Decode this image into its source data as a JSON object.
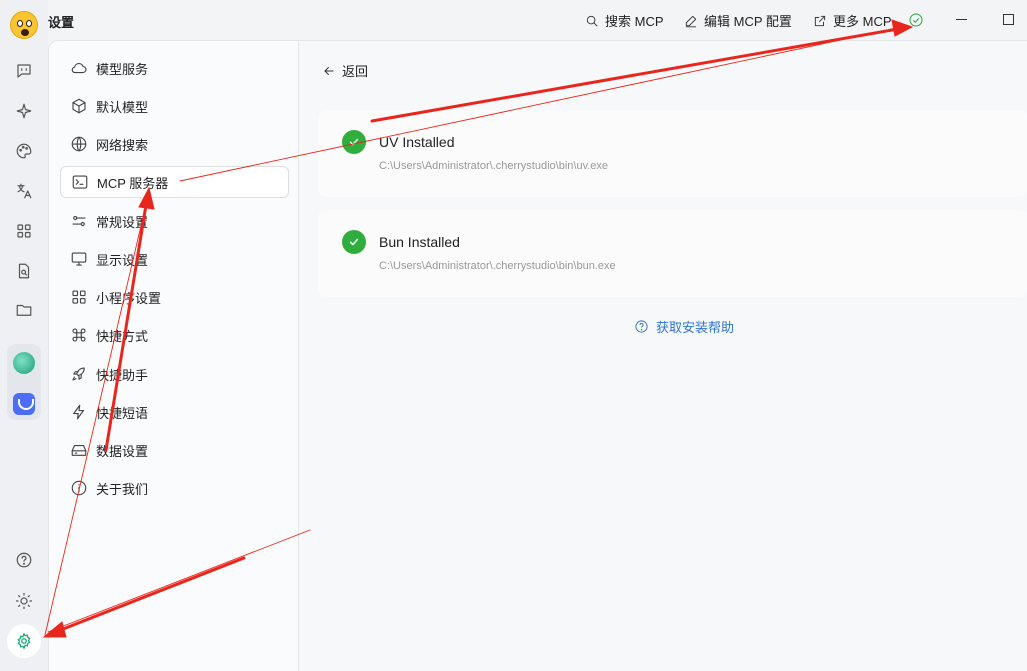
{
  "window": {
    "title": "设置",
    "toolbar": {
      "search_label": "搜索 MCP",
      "edit_label": "编辑 MCP 配置",
      "more_label": "更多 MCP"
    }
  },
  "rail": {
    "icons": [
      "chat-icon",
      "sparkle-icon",
      "palette-icon",
      "translate-icon",
      "apps-grid-icon",
      "doc-search-icon",
      "folder-icon"
    ],
    "bottom_icons": [
      "help-icon",
      "brightness-icon",
      "settings-icon"
    ]
  },
  "settings_menu": {
    "items": [
      {
        "label": "模型服务",
        "icon": "cloud-icon"
      },
      {
        "label": "默认模型",
        "icon": "cube-icon"
      },
      {
        "label": "网络搜索",
        "icon": "globe-icon"
      },
      {
        "label": "MCP 服务器",
        "icon": "terminal-icon",
        "active": true
      },
      {
        "label": "常规设置",
        "icon": "sliders-icon"
      },
      {
        "label": "显示设置",
        "icon": "monitor-icon"
      },
      {
        "label": "小程序设置",
        "icon": "grid-icon"
      },
      {
        "label": "快捷方式",
        "icon": "command-icon"
      },
      {
        "label": "快捷助手",
        "icon": "rocket-icon"
      },
      {
        "label": "快捷短语",
        "icon": "bolt-icon"
      },
      {
        "label": "数据设置",
        "icon": "storage-icon"
      },
      {
        "label": "关于我们",
        "icon": "info-icon"
      }
    ]
  },
  "main": {
    "back_label": "返回",
    "installs": [
      {
        "title": "UV Installed",
        "path": "C:\\Users\\Administrator\\.cherrystudio\\bin\\uv.exe"
      },
      {
        "title": "Bun Installed",
        "path": "C:\\Users\\Administrator\\.cherrystudio\\bin\\bun.exe"
      }
    ],
    "help_label": "获取安装帮助"
  },
  "colors": {
    "success": "#2fad3d",
    "link": "#2e74c9",
    "accent_settings": "#17a673",
    "annotation_arrow": "#e8261d"
  }
}
